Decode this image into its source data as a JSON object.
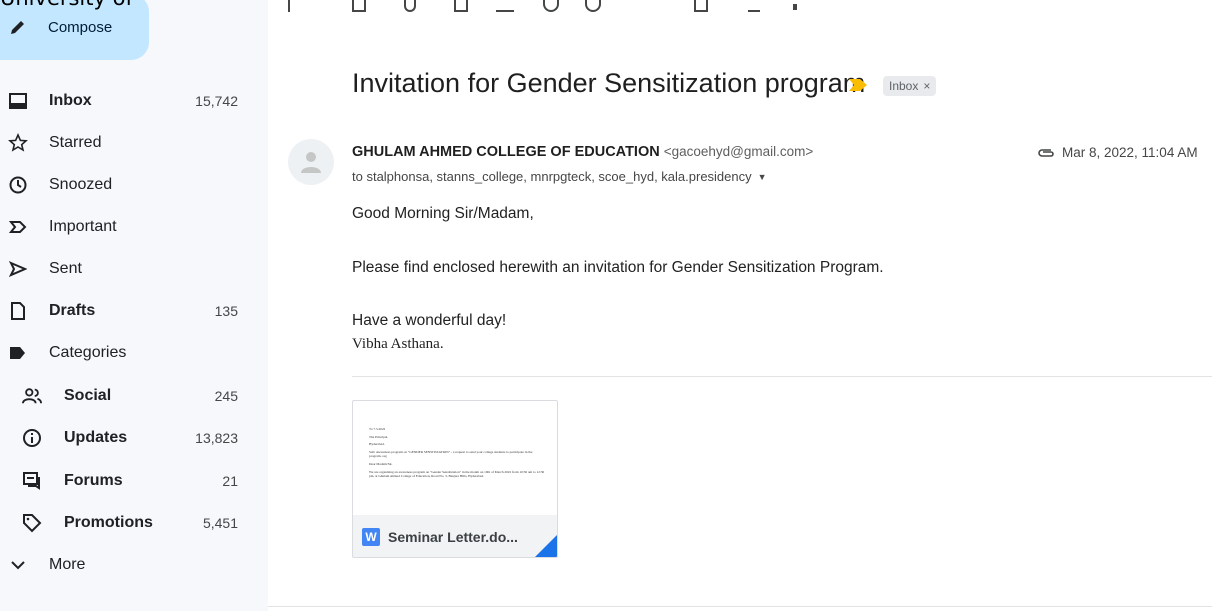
{
  "overlay": {
    "text": "University of"
  },
  "sidebar": {
    "compose_label": "Compose",
    "items": [
      {
        "label": "Inbox",
        "count": "15,742"
      },
      {
        "label": "Starred",
        "count": ""
      },
      {
        "label": "Snoozed",
        "count": ""
      },
      {
        "label": "Important",
        "count": ""
      },
      {
        "label": "Sent",
        "count": ""
      },
      {
        "label": "Drafts",
        "count": "135"
      },
      {
        "label": "Categories",
        "count": ""
      },
      {
        "label": "Social",
        "count": "245"
      },
      {
        "label": "Updates",
        "count": "13,823"
      },
      {
        "label": "Forums",
        "count": "21"
      },
      {
        "label": "Promotions",
        "count": "5,451"
      },
      {
        "label": "More",
        "count": ""
      }
    ]
  },
  "email": {
    "subject": "Invitation for Gender Sensitization program",
    "label_chip": "Inbox",
    "label_chip_close": "×",
    "sender_name": "GHULAM AHMED COLLEGE OF EDUCATION",
    "sender_email": "<gacoehyd@gmail.com>",
    "date": "Mar 8, 2022, 11:04 AM",
    "recipients": "to stalphonsa, stanns_college, mnrpgteck, scoe_hyd, kala.presidency",
    "greeting": "Good Morning Sir/Madam,",
    "body": "Please find enclosed herewith an invitation for Gender Sensitization Program.",
    "closing": "Have a wonderful day!",
    "signature": "Vibha Asthana."
  },
  "attachment": {
    "filename": "Seminar Letter.do...",
    "type_badge": "W",
    "preview_lines": [
      "To                                                                                    7.3.2022",
      "The Principal,",
      "Hyderabad.",
      "Sub: Awareness program on \"GENDER SENSITIZATION\" - a request to send your college students to participate in the program- reg",
      "Dear Madam/Sir,",
      "We are organizing an awareness program on \"Gender Sensitization\" in the month on 10th of March 2022 from 10:30 am to 12:30 pm, at Ghulam Ahmed College of Education, Road No. 3, Banjara Hills, Hyderabad."
    ]
  },
  "colors": {
    "sidebar_bg": "#f6f8fc",
    "compose_bg": "#c2e7ff",
    "importance_marker": "#fbbc04",
    "word_blue": "#4285f4"
  }
}
